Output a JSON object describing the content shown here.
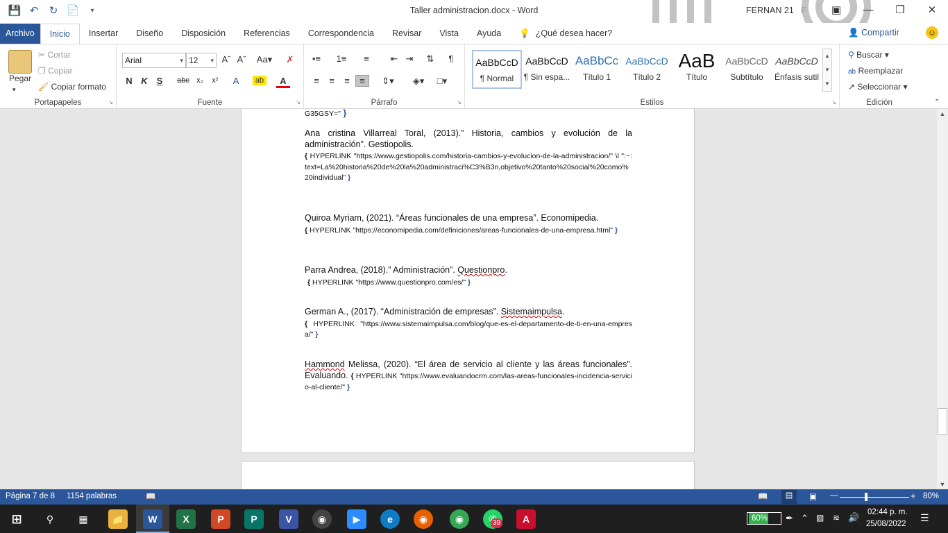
{
  "window": {
    "title": "Taller administracion.docx  -  Word",
    "user": "FERNAN 21",
    "user_initial": "F"
  },
  "tabs": [
    "Archivo",
    "Inicio",
    "Insertar",
    "Diseño",
    "Disposición",
    "Referencias",
    "Correspondencia",
    "Revisar",
    "Vista",
    "Ayuda"
  ],
  "tellme": "¿Qué desea hacer?",
  "share": "Compartir",
  "clipboard": {
    "paste": "Pegar",
    "cut": "Cortar",
    "copy": "Copiar",
    "format_painter": "Copiar formato",
    "label": "Portapapeles"
  },
  "font": {
    "name": "Arial",
    "size": "12",
    "label": "Fuente"
  },
  "paragraph": {
    "label": "Párrafo"
  },
  "styles": {
    "label": "Estilos",
    "items": [
      {
        "preview": "AaBbCcD",
        "name": "¶ Normal"
      },
      {
        "preview": "AaBbCcD",
        "name": "¶ Sin espa..."
      },
      {
        "preview": "AaBbCc",
        "name": "Título 1"
      },
      {
        "preview": "AaBbCcD",
        "name": "Título 2"
      },
      {
        "preview": "AaB",
        "name": "Título"
      },
      {
        "preview": "AaBbCcD",
        "name": "Subtítulo"
      },
      {
        "preview": "AaBbCcD",
        "name": "Énfasis sutil"
      }
    ]
  },
  "editing": {
    "find": "Buscar",
    "replace": "Reemplazar",
    "select": "Seleccionar",
    "label": "Edición"
  },
  "doc": {
    "top_fragment": "G35GSY=\"",
    "refs": [
      {
        "citation": "Ana cristina Villarreal Toral, (2013).” Historia, cambios y evolución de la administración”. Gestiopolis.",
        "field": "HYPERLINK \"https://www.gestiopolis.com/historia-cambios-y-evolucion-de-la-administracion/\" \\l \":~:text=La%20historia%20de%20la%20administraci%C3%B3n,objetivo%20tanto%20social%20como%20individual\""
      },
      {
        "citation": " Quiroa Myriam, (2021). “Áreas funcionales de una empresa”. Economipedia.",
        "field": "HYPERLINK \"https://economipedia.com/definiciones/areas-funcionales-de-una-empresa.html\""
      },
      {
        "citation": "Parra Andrea, (2018).” Administración”. ",
        "squig": "Questionpro",
        "after": ".",
        "field": "HYPERLINK \"https://www.questionpro.com/es/\""
      },
      {
        "citation": "German A., (2017). “Administración de empresas”. ",
        "squig": "Sistemaimpulsa",
        "after": ".",
        "field": "HYPERLINK \"https://www.sistemaimpulsa.com/blog/que-es-el-departamento-de-ti-en-una-empresa/\""
      },
      {
        "squig": "Hammond",
        "citation": " Melissa, (2020). “El área de servicio al cliente y las áreas funcionales”. Evaluando.",
        "field": "HYPERLINK \"https://www.evaluandocrm.com/las-areas-funcionales-incidencia-servicio-al-cliente/\""
      }
    ]
  },
  "status": {
    "page": "Página 7 de 8",
    "words": "1154 palabras",
    "zoom": "80%"
  },
  "taskbar": {
    "battery": "60%",
    "time": "02:44 p. m.",
    "date": "25/08/2022",
    "whatsapp_badge": "39"
  }
}
